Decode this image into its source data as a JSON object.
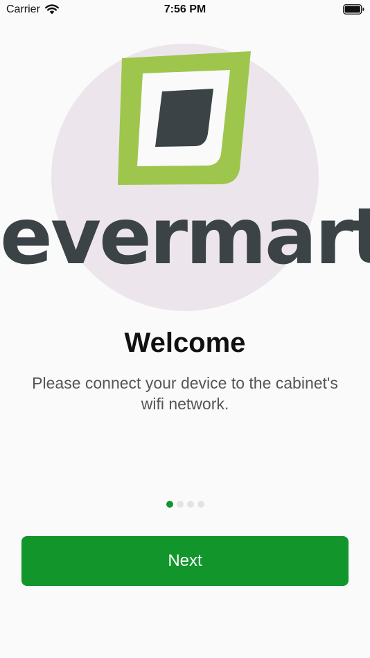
{
  "status_bar": {
    "carrier": "Carrier",
    "time": "7:56 PM",
    "wifi_icon": "wifi-icon",
    "battery_icon": "battery-icon"
  },
  "logo": {
    "wordmark": "evermart",
    "mark_icon": "evermart-logo-icon"
  },
  "welcome": {
    "title": "Welcome",
    "message": "Please connect your device to the cabinet's wifi network."
  },
  "pager": {
    "total": 4,
    "active": 0
  },
  "next_button": {
    "label": "Next"
  },
  "colors": {
    "background": "#fafafa",
    "circle": "#ece6ec",
    "logo_green": "#9ec64c",
    "logo_dark": "#3b4347",
    "accent_green": "#12962c",
    "dot_inactive": "#e3e3e3"
  }
}
